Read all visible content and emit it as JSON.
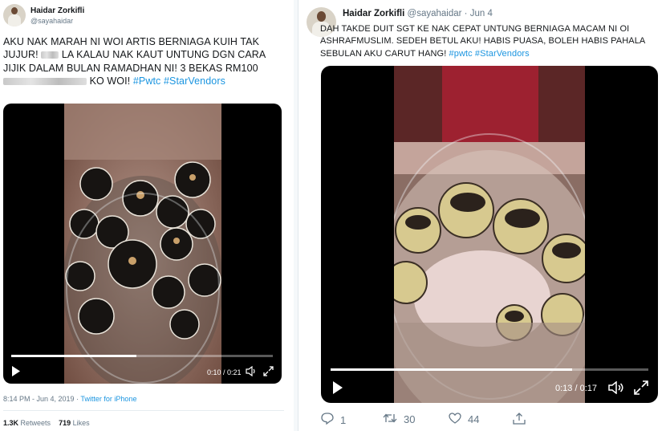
{
  "left_tweet": {
    "author_name": "Haidar Zorkifli",
    "author_handle": "@sayahaidar",
    "text_line1": "AKU NAK MARAH NI WOI ARTIS BERNIAGA KUIH TAK",
    "text_line2a": "JUJUR!",
    "text_line2b": "LA KALAU NAK KAUT UNTUNG DGN CARA",
    "text_line3": "JIJIK DALAM BULAN RAMADHAN NI! 3 BEKAS RM100",
    "text_line4a": "KO WOI!",
    "hashtag1": "#Pwtc",
    "hashtag2": "#StarVendors",
    "video": {
      "time": "0:10 / 0:21",
      "progress": 0.48
    },
    "timestamp": "8:14 PM - Jun 4, 2019",
    "separator": "·",
    "source": "Twitter for iPhone",
    "retweets_count": "1.3K",
    "retweets_label": "Retweets",
    "likes_count": "719",
    "likes_label": "Likes"
  },
  "right_tweet": {
    "author_name": "Haidar Zorkifli",
    "author_handle": "@sayahaidar",
    "separator": "·",
    "date": "Jun 4",
    "text_line1": "DAH TAKDE DUIT SGT KE NAK CEPAT UNTUNG BERNIAGA MACAM NI OI",
    "text_line2": "ASHRAFMUSLIM. SEDEH BETUL AKU! HABIS PUASA, BOLEH HABIS PAHALA",
    "text_line3": "SEBULAN AKU CARUT HANG!",
    "hashtag1": "#pwtc",
    "hashtag2": "#StarVendors",
    "video": {
      "time": "0:13 / 0:17",
      "progress": 0.76
    },
    "actions": {
      "reply_count": "1",
      "retweet_count": "30",
      "like_count": "44"
    }
  },
  "colors": {
    "link": "#1b95e0",
    "muted": "#657786",
    "text": "#14171a"
  },
  "icons": [
    "play-icon",
    "volume-icon",
    "fullscreen-icon",
    "reply-icon",
    "retweet-icon",
    "like-icon",
    "share-icon"
  ]
}
